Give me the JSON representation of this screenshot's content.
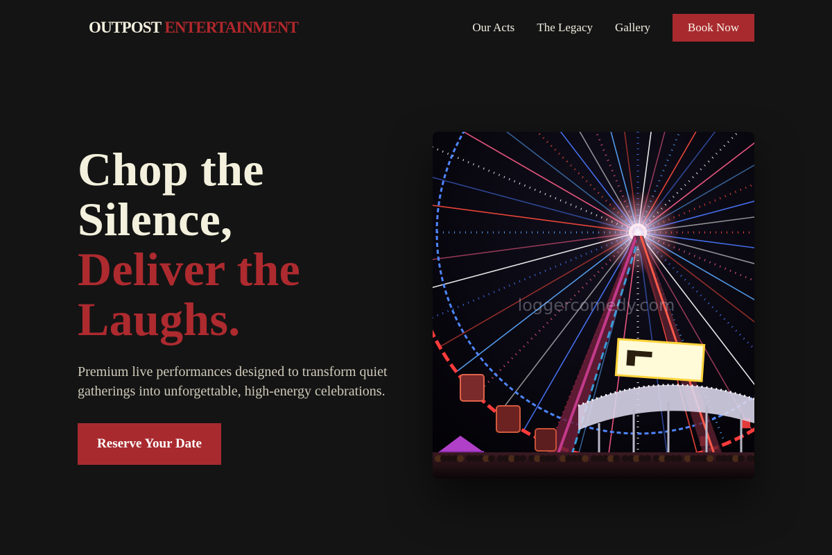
{
  "brand": {
    "name_part1": "OUTPOST",
    "name_part2": "ENTERTAINMENT"
  },
  "nav": {
    "items": [
      {
        "label": "Our Acts"
      },
      {
        "label": "The Legacy"
      },
      {
        "label": "Gallery"
      }
    ],
    "cta_label": "Book Now"
  },
  "hero": {
    "headline_line1": "Chop the",
    "headline_line2": "Silence,",
    "headline_line3": "Deliver the",
    "headline_line4": "Laughs.",
    "subtitle": "Premium live performances designed to transform quiet gatherings into unforgettable, high-energy celebrations.",
    "cta_label": "Reserve Your Date",
    "image": {
      "watermark": "loggercomedy.com",
      "subject": "illuminated ferris wheel at night"
    }
  },
  "colors": {
    "background": "#141414",
    "accent_red": "#a82a2f",
    "cream": "#f3f1dd",
    "body_text": "#cfcbbb"
  }
}
